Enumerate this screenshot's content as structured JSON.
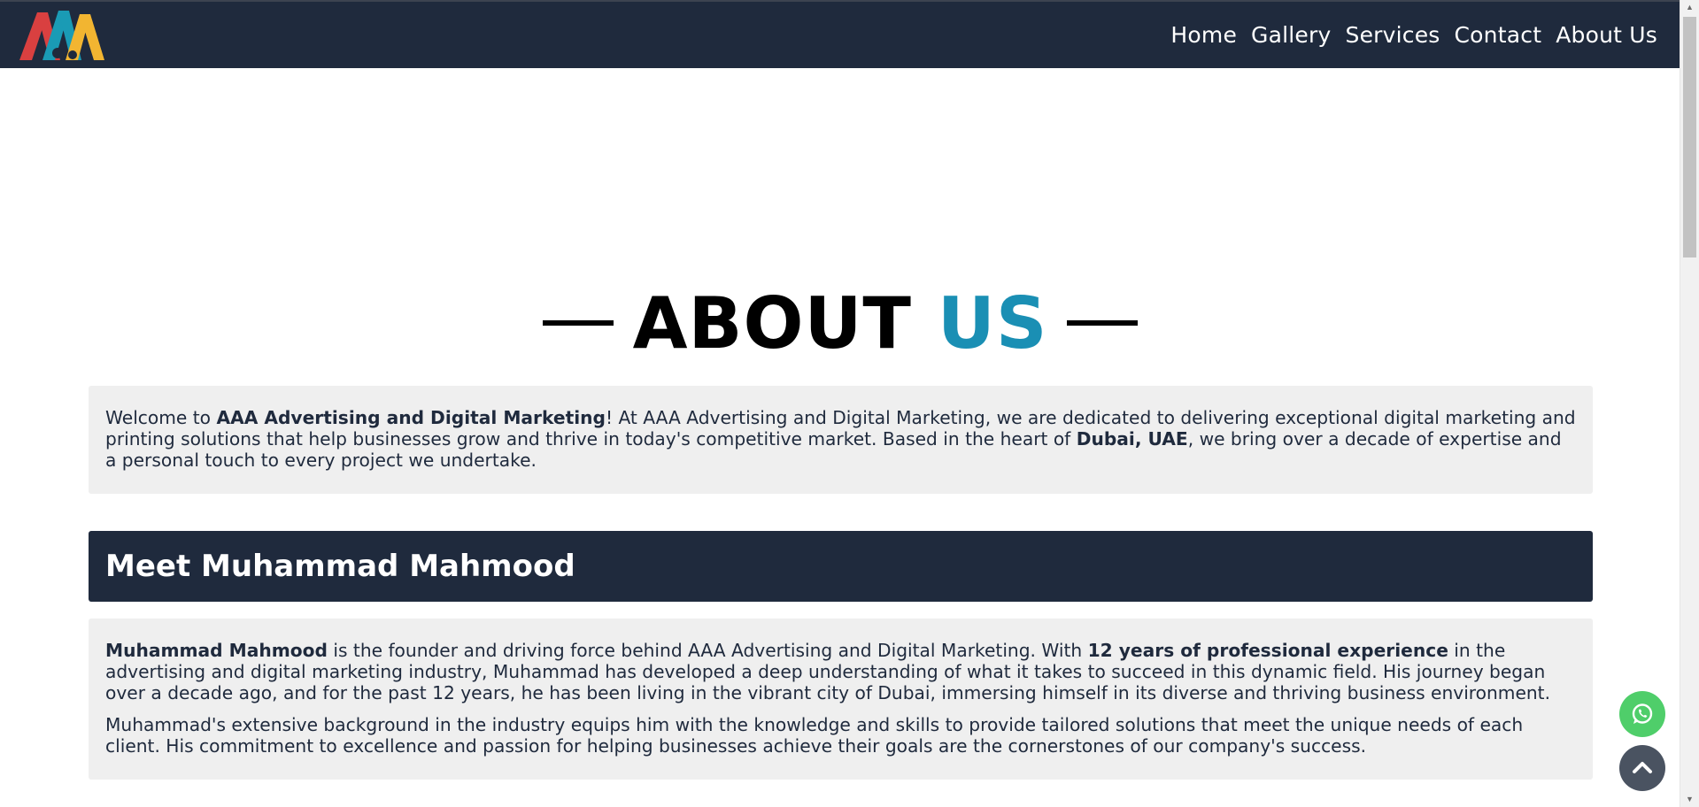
{
  "brand": {
    "logo_text": "AAA",
    "colors": {
      "navbar": "#1f2a3d",
      "accent": "#1a8fb4",
      "logo_red": "#d94040",
      "logo_teal": "#1a9bb5",
      "logo_yellow": "#f2b531"
    }
  },
  "nav": {
    "items": [
      {
        "label": "Home"
      },
      {
        "label": "Gallery"
      },
      {
        "label": "Services"
      },
      {
        "label": "Contact"
      },
      {
        "label": "About Us"
      }
    ]
  },
  "hero": {
    "title_main": "ABOUT",
    "title_accent": "US"
  },
  "intro": {
    "t1": "Welcome to ",
    "b1": "AAA Advertising and Digital Marketing",
    "t2": "! At AAA Advertising and Digital Marketing, we are dedicated to delivering exceptional digital marketing and printing solutions that help businesses grow and thrive in today's competitive market. Based in the heart of ",
    "b2": "Dubai, UAE",
    "t3": ", we bring over a decade of expertise and a personal touch to every project we undertake."
  },
  "founder": {
    "section_title": "Meet Muhammad Mahmood",
    "p1_b1": "Muhammad Mahmood",
    "p1_t1": " is the founder and driving force behind AAA Advertising and Digital Marketing. With ",
    "p1_b2": "12 years of professional experience",
    "p1_t2": " in the advertising and digital marketing industry, Muhammad has developed a deep understanding of what it takes to succeed in this dynamic field. His journey began over a decade ago, and for the past 12 years, he has been living in the vibrant city of Dubai, immersing himself in its diverse and thriving business environment.",
    "p2": "Muhammad's extensive background in the industry equips him with the knowledge and skills to provide tailored solutions that meet the unique needs of each client. His commitment to excellence and passion for helping businesses achieve their goals are the cornerstones of our company's success."
  },
  "floating": {
    "whatsapp_icon": "whatsapp-icon",
    "top_icon": "chevron-up-icon"
  }
}
